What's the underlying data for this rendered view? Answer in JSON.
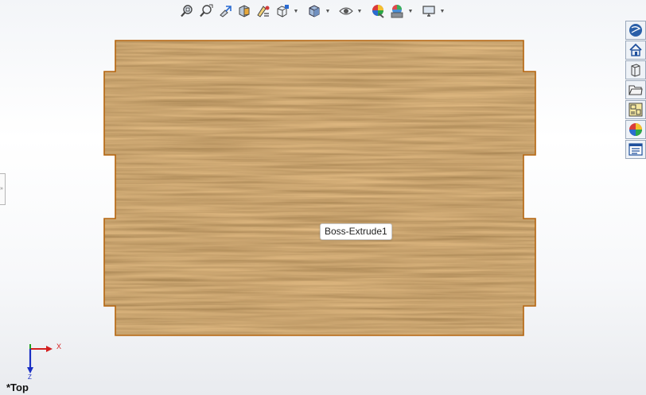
{
  "viewport": {
    "view_name": "*Top",
    "tooltip": "Boss-Extrude1",
    "triad": {
      "x_label": "X",
      "z_label": "Z"
    }
  },
  "hud_toolbar": {
    "items": [
      {
        "icon": "zoom-to-fit-icon"
      },
      {
        "icon": "zoom-to-area-icon"
      },
      {
        "icon": "previous-view-icon"
      },
      {
        "icon": "section-view-icon"
      },
      {
        "icon": "dynamic-annotation-icon"
      },
      {
        "icon": "view-orientation-icon",
        "dropdown": true
      },
      {
        "icon": "display-style-icon",
        "dropdown": true
      },
      {
        "icon": "hide-show-items-icon",
        "dropdown": true
      },
      {
        "icon": "edit-appearance-icon"
      },
      {
        "icon": "apply-scene-icon",
        "dropdown": true
      },
      {
        "icon": "view-settings-icon",
        "dropdown": true
      }
    ]
  },
  "task_pane": {
    "tabs": [
      {
        "icon": "solidworks-resources-icon"
      },
      {
        "icon": "home-icon"
      },
      {
        "icon": "design-library-icon"
      },
      {
        "icon": "file-explorer-icon"
      },
      {
        "icon": "view-palette-icon"
      },
      {
        "icon": "appearances-scenes-icon"
      },
      {
        "icon": "custom-properties-icon"
      }
    ]
  },
  "colors": {
    "wood_base": "#9c6a35",
    "wood_edge": "#b5650f",
    "axis_x": "#d42020",
    "axis_y": "#1fa01f",
    "axis_z": "#1a2fc4"
  }
}
